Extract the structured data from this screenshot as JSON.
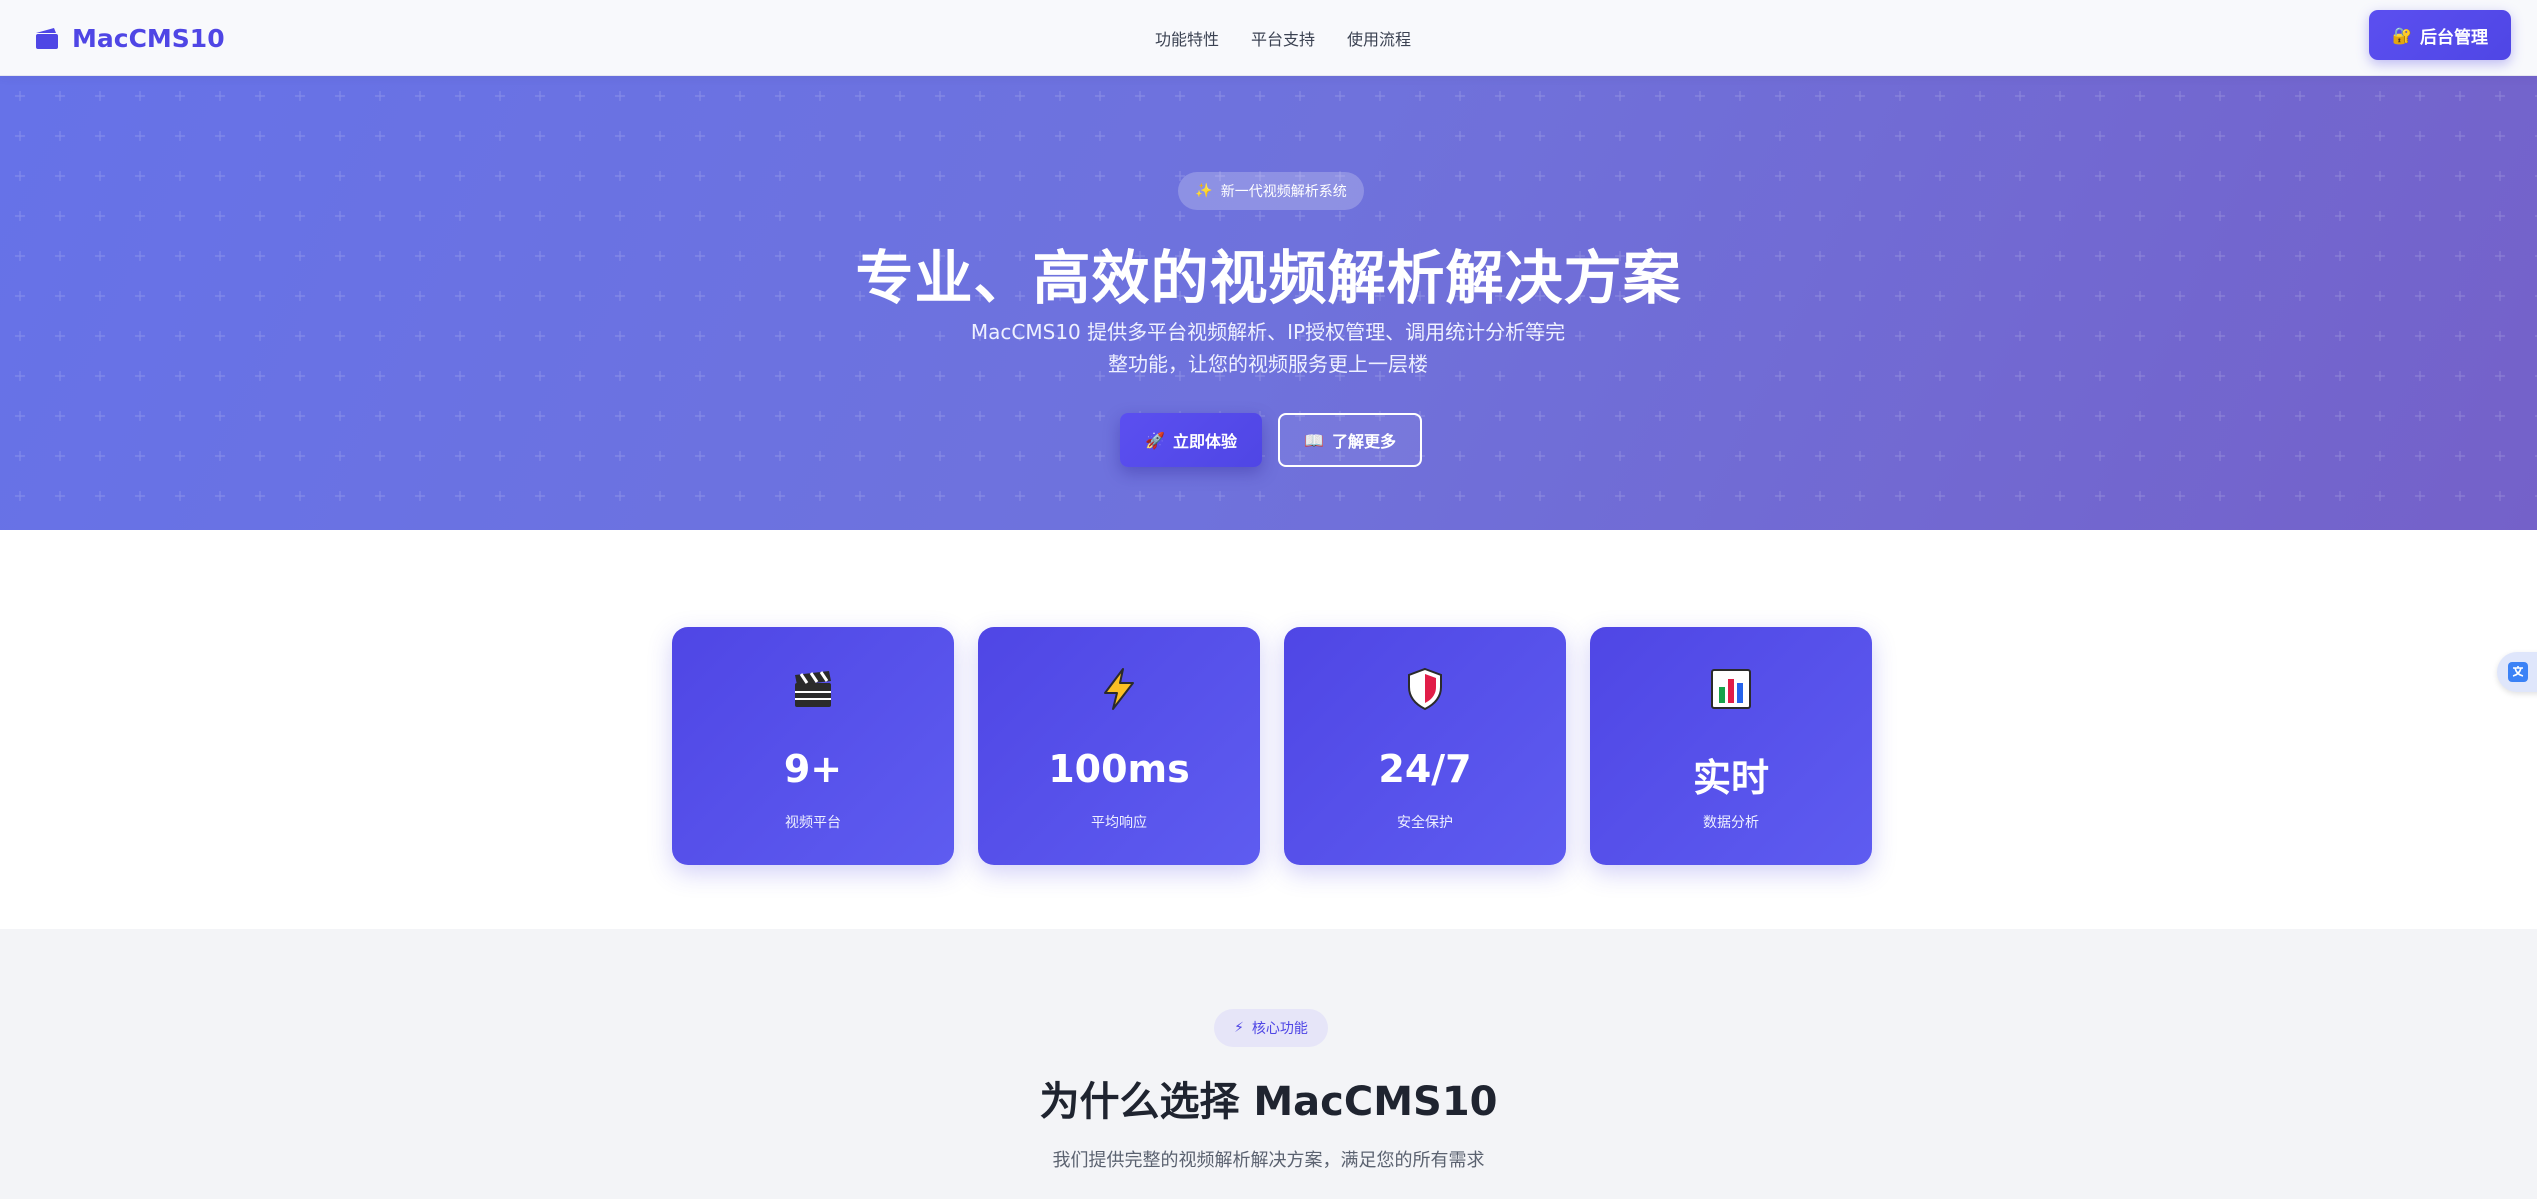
{
  "header": {
    "logo_text": "MacCMS10",
    "nav": [
      "功能特性",
      "平台支持",
      "使用流程"
    ],
    "admin_button": "后台管理"
  },
  "hero": {
    "badge": "新一代视频解析系统",
    "title": "专业、高效的视频解析解决方案",
    "subtitle_line1": "MacCMS10 提供多平台视频解析、IP授权管理、调用统计分析等完",
    "subtitle_line2": "整功能，让您的视频服务更上一层楼",
    "primary_button": "立即体验",
    "secondary_button": "了解更多"
  },
  "stats": [
    {
      "icon": "clapperboard-icon",
      "value": "9+",
      "label": "视频平台"
    },
    {
      "icon": "lightning-icon",
      "value": "100ms",
      "label": "平均响应"
    },
    {
      "icon": "shield-icon",
      "value": "24/7",
      "label": "安全保护"
    },
    {
      "icon": "bar-chart-icon",
      "value": "实时",
      "label": "数据分析"
    }
  ],
  "features": {
    "badge": "核心功能",
    "title": "为什么选择 MacCMS10",
    "subtitle": "我们提供完整的视频解析解决方案，满足您的所有需求"
  },
  "colors": {
    "accent": "#4f46e5",
    "hero_start": "#6672e8",
    "hero_end": "#7461c9",
    "section_bg": "#f3f4f7"
  }
}
